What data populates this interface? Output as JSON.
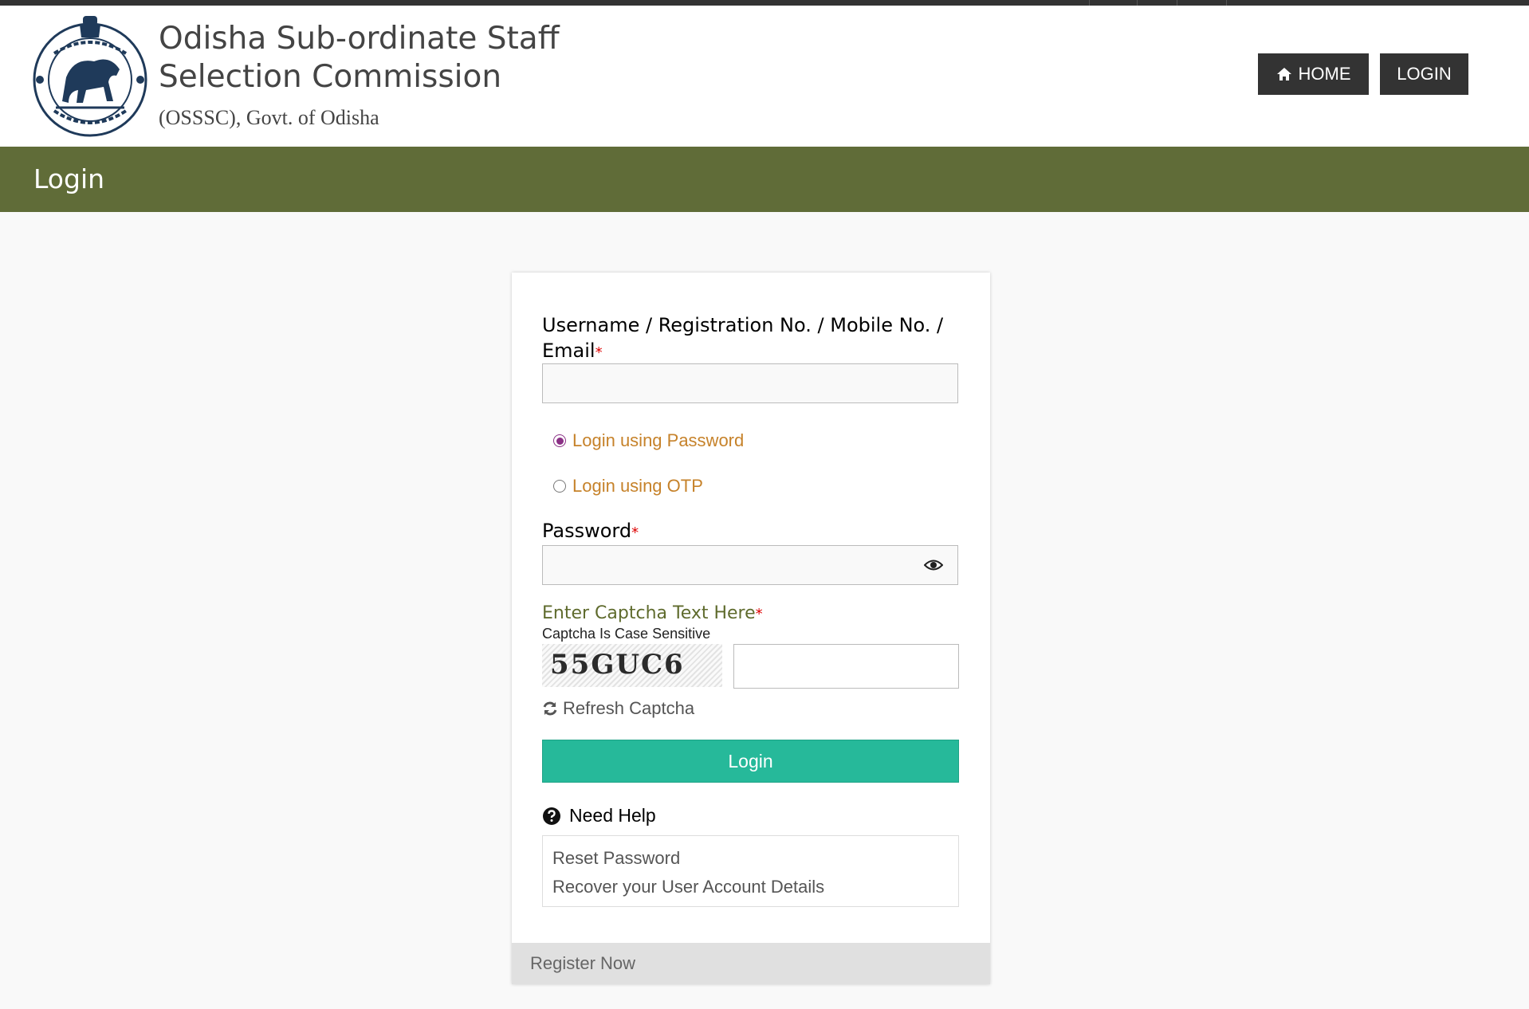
{
  "header": {
    "title_line1": "Odisha Sub-ordinate Staff",
    "title_line2": "Selection Commission",
    "subtitle": "(OSSSC), Govt. of Odisha",
    "emblem_icon": "odisha-emblem-icon"
  },
  "nav": {
    "home_label": "HOME",
    "home_icon": "home-icon",
    "login_label": "LOGIN"
  },
  "page": {
    "title": "Login",
    "title_bar_color": "#606c38"
  },
  "form": {
    "username_label": "Username / Registration No. / Mobile No. /",
    "username_label_line2": "Email",
    "required_mark": "*",
    "username_value": "",
    "login_mode_options": [
      {
        "label": "Login using Password",
        "selected": true
      },
      {
        "label": "Login using OTP",
        "selected": false
      }
    ],
    "password_label": "Password",
    "password_value": "",
    "captcha_label": "Enter Captcha Text Here",
    "captcha_note": "Captcha Is Case Sensitive",
    "captcha_text": "55GUC6",
    "captcha_value": "",
    "refresh_label": "Refresh Captcha",
    "submit_label": "Login",
    "submit_color": "#26b99a"
  },
  "help": {
    "heading": "Need Help",
    "links": [
      "Reset Password",
      "Recover your User Account Details"
    ]
  },
  "footer": {
    "register_label": "Register Now"
  }
}
